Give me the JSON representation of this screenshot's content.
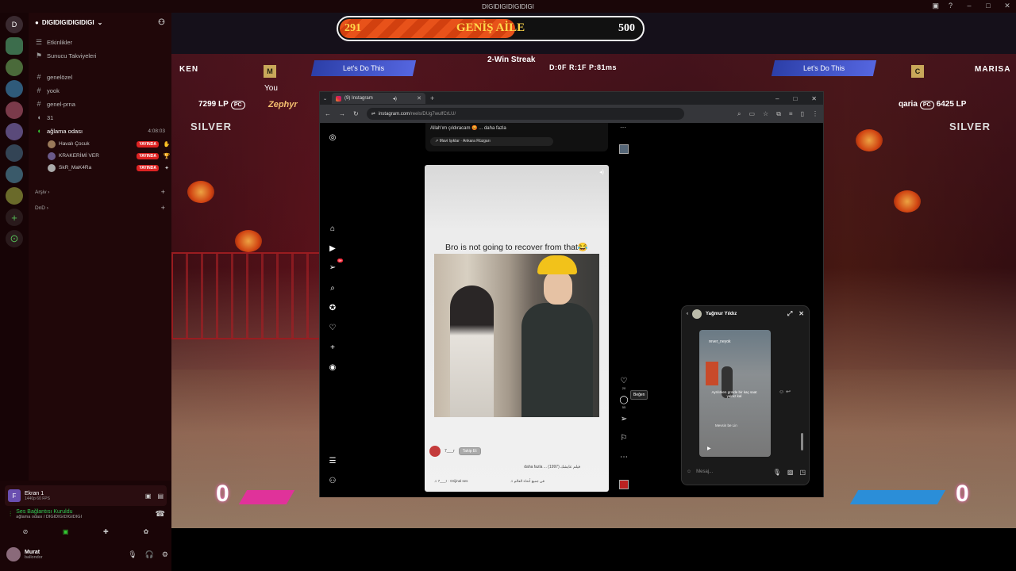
{
  "app": {
    "title": "DIGIDIGIDIGIDIGI"
  },
  "servers": [
    "D",
    "",
    "",
    "",
    "",
    "",
    "",
    "",
    "",
    "+",
    "⊙"
  ],
  "guild": {
    "name": "DIGIDIGIDIGIDIGI"
  },
  "top_channels": [
    {
      "icon": "☰",
      "label": "Etkinlikler"
    },
    {
      "icon": "⚑",
      "label": "Sunucu Takviyeleri"
    }
  ],
  "channels": [
    {
      "label": "genelözel"
    },
    {
      "label": "yook"
    },
    {
      "label": "genel-prna"
    },
    {
      "label": "31"
    }
  ],
  "voice_channel": {
    "label": "ağlama odası",
    "time": "4:08:03"
  },
  "voice_users": [
    {
      "name": "Havalı Çocuk",
      "live": "YAYINDA",
      "icon": "✋"
    },
    {
      "name": "KRAKERİMİ VER",
      "live": "YAYINDA",
      "icon": "🏆"
    },
    {
      "name": "SkR_MaK4Ra",
      "live": "YAYINDA",
      "icon": "✦"
    }
  ],
  "categories": [
    {
      "label": "Arşiv ›",
      "plus": "+"
    },
    {
      "label": "DnD ›",
      "plus": "+"
    }
  ],
  "screen_share": {
    "title": "Ekran 1",
    "sub": "1440p 60 FPS"
  },
  "voice_status": {
    "title": "Ses Bağlantısı Kuruldu",
    "sub": "ağlama odası / DIGIDIGIDIGIDIGI"
  },
  "me": {
    "name": "Murat",
    "status": "ballondor"
  },
  "counter": {
    "level": "291",
    "title": "GENİŞ AİLE",
    "max": "500",
    "fraction": 0.582
  },
  "game": {
    "p1_name": "KEN",
    "p2_name": "MARISA",
    "p1_banner": "Let's Do This",
    "p2_banner": "Let's Do This",
    "streak": "2-Win Streak",
    "stats": "D:0F   R:1F   P:81ms",
    "you": "You",
    "p1_player": "Zephyr",
    "p2_player": "qaria",
    "p1_lp": "7299 LP",
    "p2_lp": "6425 LP",
    "platform": "PC",
    "p1_rank": "SILVER",
    "p2_rank": "SILVER",
    "p1_badge": "M",
    "p2_badge": "C",
    "p1_round": "0",
    "p2_round": "0"
  },
  "browser": {
    "tab_title": "(9) Instagram",
    "url_host": "instagram.com",
    "url_path": "/reels/DUg7wulfCrLU/"
  },
  "instagram": {
    "prev_caption": "Allah'ım çıldıracam 😡 ... daha fazla",
    "prev_audio": "↗ Mavi Işıklar · Ankara Rüzgarı",
    "reel_caption": "Bro is not going to recover from that😂",
    "author": "7___r",
    "follow": "Takip Et",
    "description": "daha fazla ... (1997) فيلم عايشك",
    "audio_left": "♫ 7___r · Orijinal ses",
    "audio_right": "♫ في جميع أنحاء العالم",
    "like_count": "20",
    "comment_count": "55",
    "tooltip": "Beğen",
    "notif_count": "9+"
  },
  "dm": {
    "name": "Yağmur Yıldız",
    "thumb_user": "rever_neyok",
    "thumb_text": "Ayrılırken günde bir kaç saat yalnız kal",
    "thumb_text2": "Mevsin be Lin",
    "placeholder": "Mesaj..."
  }
}
